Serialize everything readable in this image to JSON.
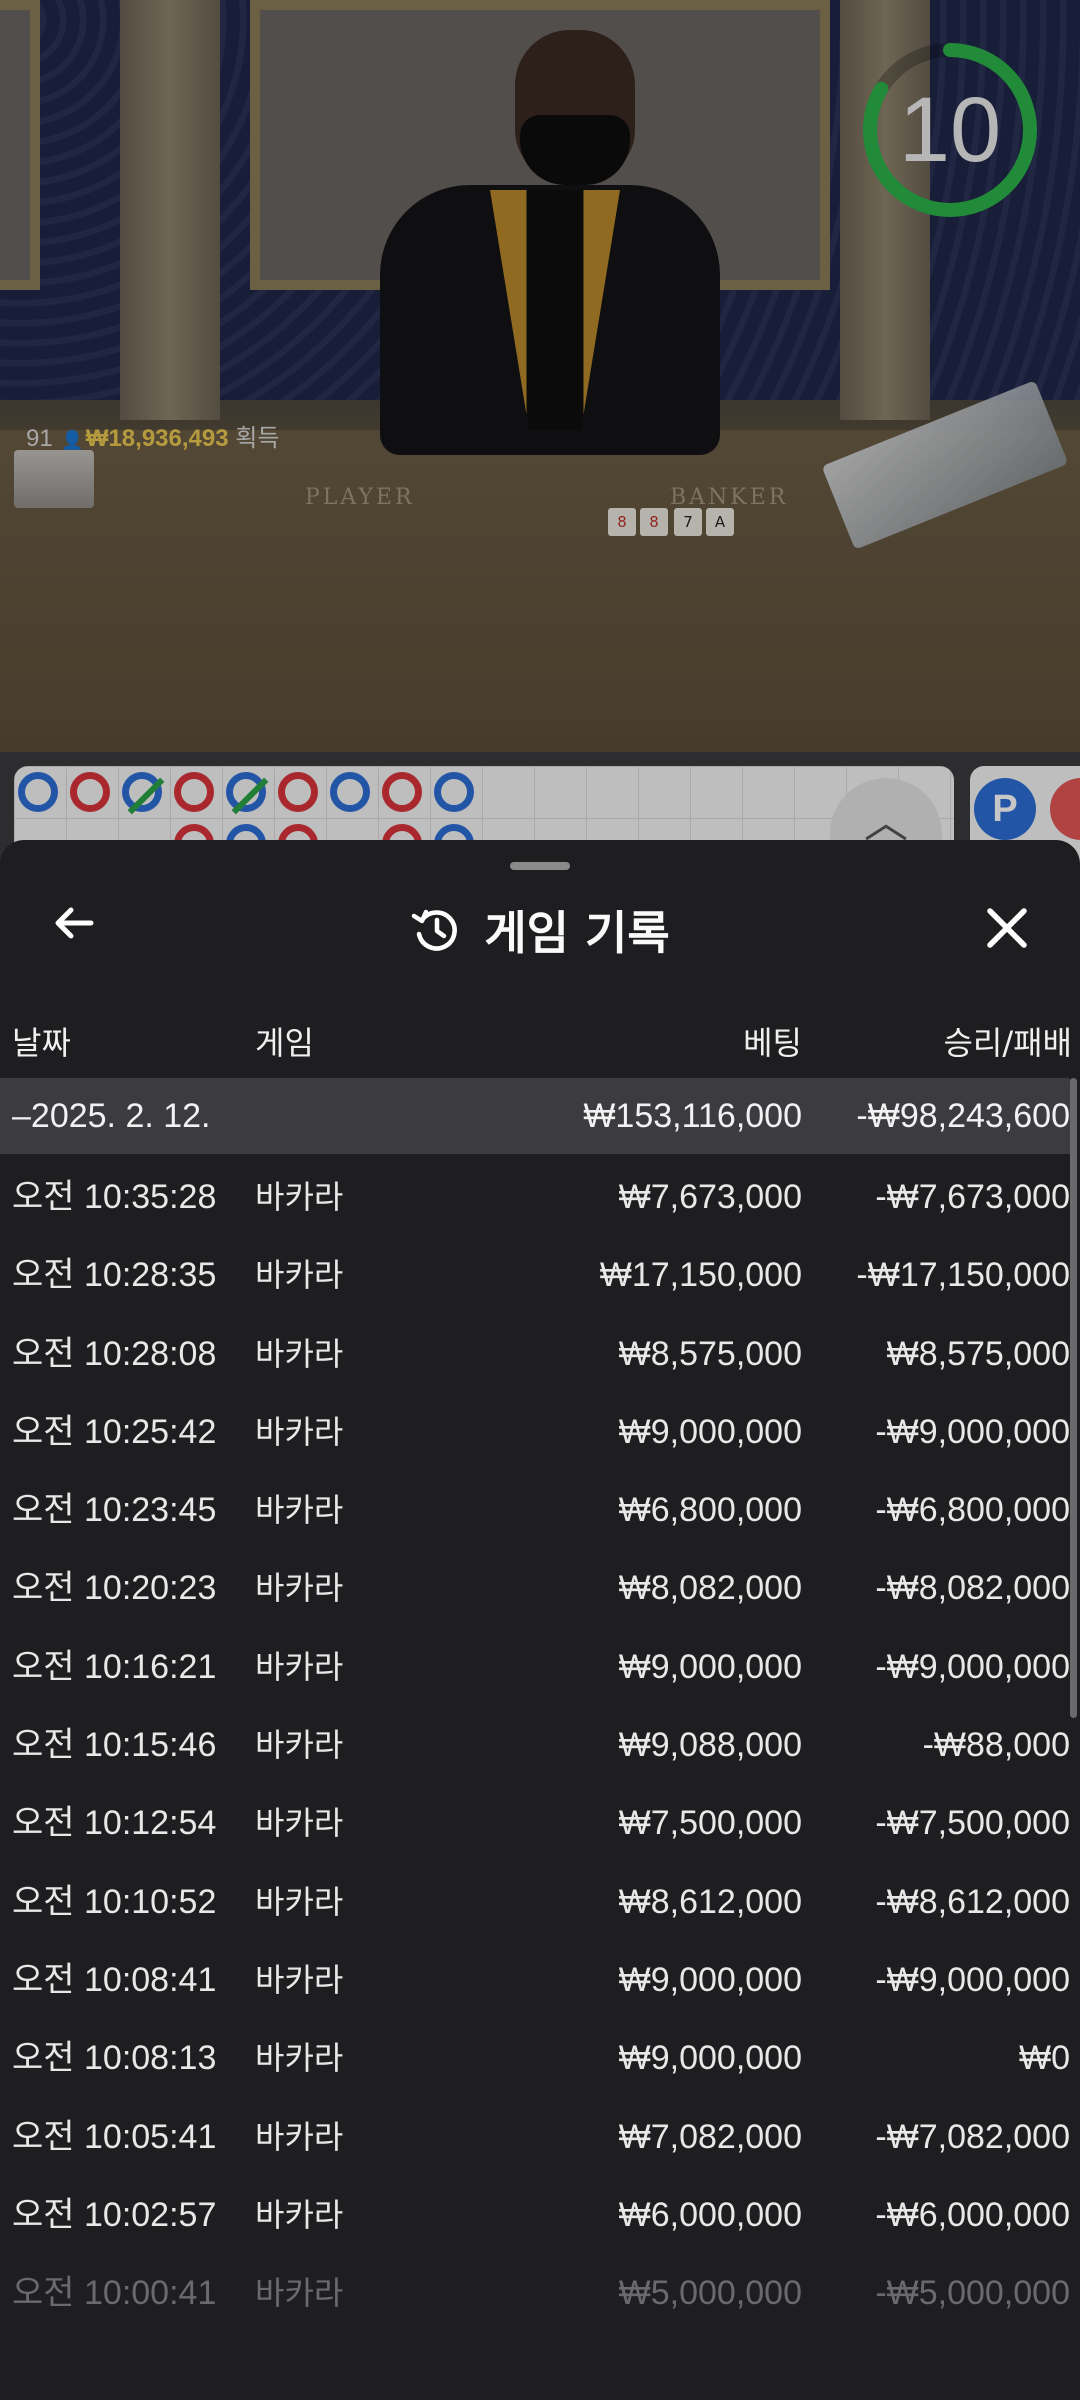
{
  "video": {
    "timer": "10",
    "winners_count": "91",
    "winners_amount": "₩18,936,493",
    "winners_suffix": "획득",
    "table_player": "PLAYER",
    "table_banker": "BANKER",
    "timer_color": "#2bb34a"
  },
  "road": {
    "player_badge": "P",
    "player_color": "#2d6ed6",
    "banker_color": "#d8343a",
    "tie_color": "#2aa247"
  },
  "sheet": {
    "title": "게임 기록",
    "back_icon": "arrow-left-icon",
    "history_icon": "history-icon",
    "close_icon": "close-icon",
    "headers": {
      "date": "날짜",
      "game": "게임",
      "bet": "베팅",
      "result": "승리/패배"
    },
    "summary": {
      "date": "–2025. 2. 12.",
      "bet": "₩153,116,000",
      "result": "-₩98,243,600"
    },
    "rows": [
      {
        "time": "오전 10:35:28",
        "game": "바카라",
        "bet": "₩7,673,000",
        "result": "-₩7,673,000"
      },
      {
        "time": "오전 10:28:35",
        "game": "바카라",
        "bet": "₩17,150,000",
        "result": "-₩17,150,000"
      },
      {
        "time": "오전 10:28:08",
        "game": "바카라",
        "bet": "₩8,575,000",
        "result": "₩8,575,000"
      },
      {
        "time": "오전 10:25:42",
        "game": "바카라",
        "bet": "₩9,000,000",
        "result": "-₩9,000,000"
      },
      {
        "time": "오전 10:23:45",
        "game": "바카라",
        "bet": "₩6,800,000",
        "result": "-₩6,800,000"
      },
      {
        "time": "오전 10:20:23",
        "game": "바카라",
        "bet": "₩8,082,000",
        "result": "-₩8,082,000"
      },
      {
        "time": "오전 10:16:21",
        "game": "바카라",
        "bet": "₩9,000,000",
        "result": "-₩9,000,000"
      },
      {
        "time": "오전 10:15:46",
        "game": "바카라",
        "bet": "₩9,088,000",
        "result": "-₩88,000"
      },
      {
        "time": "오전 10:12:54",
        "game": "바카라",
        "bet": "₩7,500,000",
        "result": "-₩7,500,000"
      },
      {
        "time": "오전 10:10:52",
        "game": "바카라",
        "bet": "₩8,612,000",
        "result": "-₩8,612,000"
      },
      {
        "time": "오전 10:08:41",
        "game": "바카라",
        "bet": "₩9,000,000",
        "result": "-₩9,000,000"
      },
      {
        "time": "오전 10:08:13",
        "game": "바카라",
        "bet": "₩9,000,000",
        "result": "₩0"
      },
      {
        "time": "오전 10:05:41",
        "game": "바카라",
        "bet": "₩7,082,000",
        "result": "-₩7,082,000"
      },
      {
        "time": "오전 10:02:57",
        "game": "바카라",
        "bet": "₩6,000,000",
        "result": "-₩6,000,000"
      },
      {
        "time": "오전 10:00:41",
        "game": "바카라",
        "bet": "₩5,000,000",
        "result": "-₩5,000,000"
      }
    ]
  }
}
